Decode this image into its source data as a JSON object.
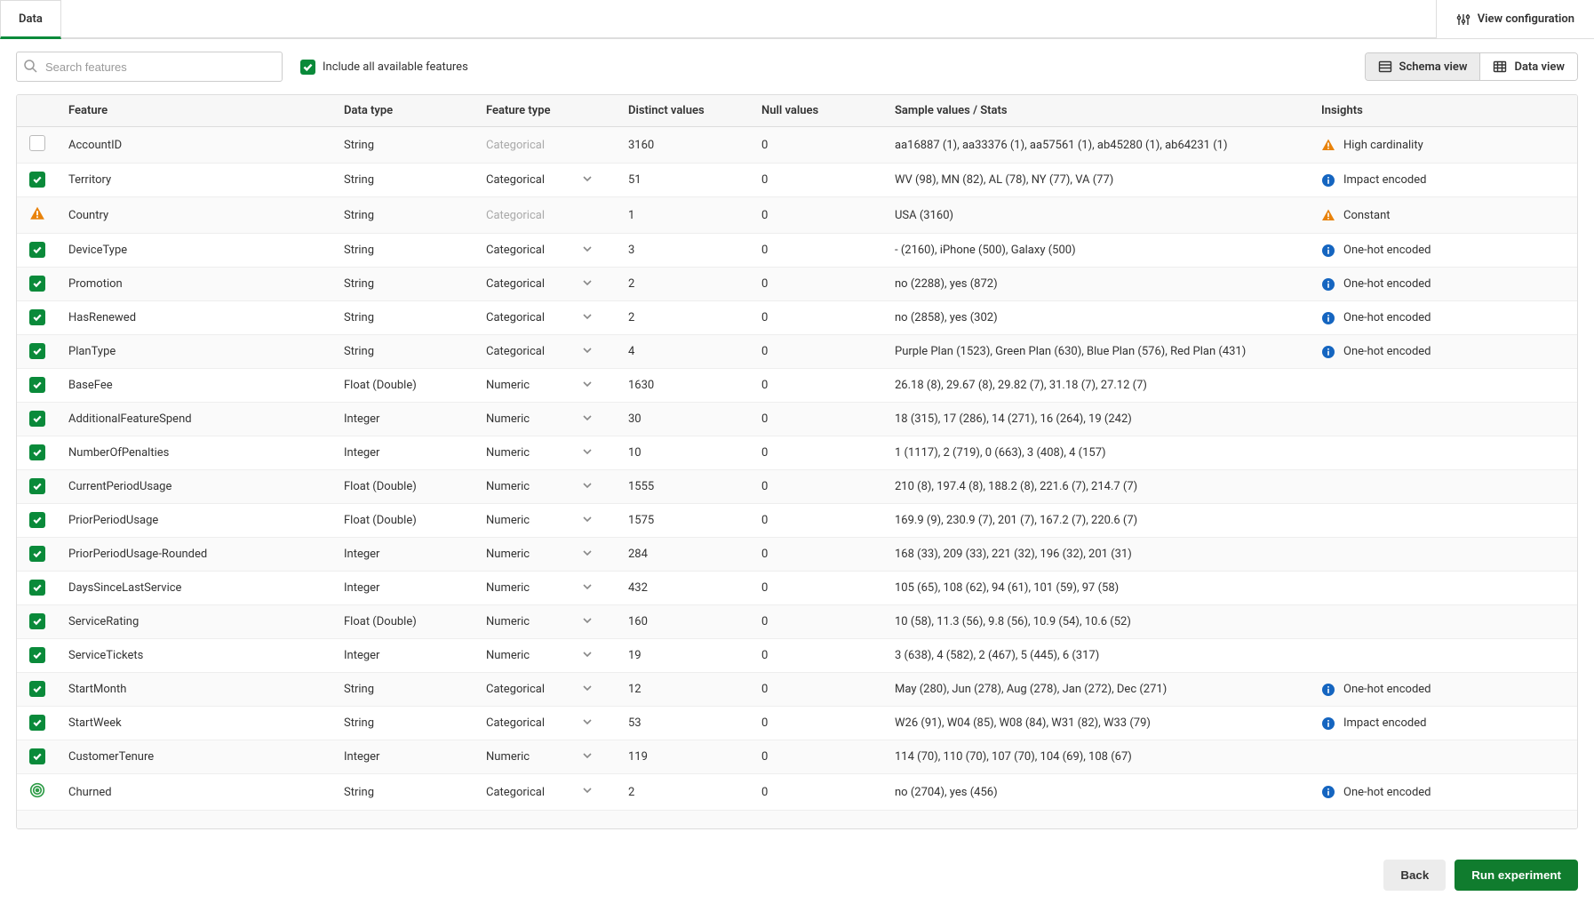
{
  "tabs": {
    "data_label": "Data"
  },
  "view_config_label": "View configuration",
  "toolbar": {
    "search_placeholder": "Search features",
    "include_all_label": "Include all available features",
    "schema_view_label": "Schema view",
    "data_view_label": "Data view"
  },
  "columns": {
    "feature": "Feature",
    "data_type": "Data type",
    "feature_type": "Feature type",
    "distinct": "Distinct values",
    "nulls": "Null values",
    "sample": "Sample values / Stats",
    "insights": "Insights"
  },
  "footer": {
    "back": "Back",
    "run": "Run experiment"
  },
  "rows": [
    {
      "status": "off",
      "feature": "AccountID",
      "data_type": "String",
      "feature_type": "Categorical",
      "ft_editable": false,
      "distinct": "3160",
      "nulls": "0",
      "sample": "aa16887 (1), aa33376 (1), aa57561 (1), ab45280 (1), ab64231 (1)",
      "insight_icon": "warn",
      "insight": "High cardinality"
    },
    {
      "status": "on",
      "feature": "Territory",
      "data_type": "String",
      "feature_type": "Categorical",
      "ft_editable": true,
      "distinct": "51",
      "nulls": "0",
      "sample": "WV (98), MN (82), AL (78), NY (77), VA (77)",
      "insight_icon": "info",
      "insight": "Impact encoded"
    },
    {
      "status": "warn",
      "feature": "Country",
      "data_type": "String",
      "feature_type": "Categorical",
      "ft_editable": false,
      "distinct": "1",
      "nulls": "0",
      "sample": "USA (3160)",
      "insight_icon": "warn",
      "insight": "Constant"
    },
    {
      "status": "on",
      "feature": "DeviceType",
      "data_type": "String",
      "feature_type": "Categorical",
      "ft_editable": true,
      "distinct": "3",
      "nulls": "0",
      "sample": "- (2160), iPhone (500), Galaxy (500)",
      "insight_icon": "info",
      "insight": "One-hot encoded"
    },
    {
      "status": "on",
      "feature": "Promotion",
      "data_type": "String",
      "feature_type": "Categorical",
      "ft_editable": true,
      "distinct": "2",
      "nulls": "0",
      "sample": "no (2288), yes (872)",
      "insight_icon": "info",
      "insight": "One-hot encoded"
    },
    {
      "status": "on",
      "feature": "HasRenewed",
      "data_type": "String",
      "feature_type": "Categorical",
      "ft_editable": true,
      "distinct": "2",
      "nulls": "0",
      "sample": "no (2858), yes (302)",
      "insight_icon": "info",
      "insight": "One-hot encoded"
    },
    {
      "status": "on",
      "feature": "PlanType",
      "data_type": "String",
      "feature_type": "Categorical",
      "ft_editable": true,
      "distinct": "4",
      "nulls": "0",
      "sample": "Purple Plan (1523), Green Plan (630), Blue Plan (576), Red Plan (431)",
      "insight_icon": "info",
      "insight": "One-hot encoded"
    },
    {
      "status": "on",
      "feature": "BaseFee",
      "data_type": "Float (Double)",
      "feature_type": "Numeric",
      "ft_editable": true,
      "distinct": "1630",
      "nulls": "0",
      "sample": "26.18 (8), 29.67 (8), 29.82 (7), 31.18 (7), 27.12 (7)",
      "insight_icon": "",
      "insight": ""
    },
    {
      "status": "on",
      "feature": "AdditionalFeatureSpend",
      "data_type": "Integer",
      "feature_type": "Numeric",
      "ft_editable": true,
      "distinct": "30",
      "nulls": "0",
      "sample": "18 (315), 17 (286), 14 (271), 16 (264), 19 (242)",
      "insight_icon": "",
      "insight": ""
    },
    {
      "status": "on",
      "feature": "NumberOfPenalties",
      "data_type": "Integer",
      "feature_type": "Numeric",
      "ft_editable": true,
      "distinct": "10",
      "nulls": "0",
      "sample": "1 (1117), 2 (719), 0 (663), 3 (408), 4 (157)",
      "insight_icon": "",
      "insight": ""
    },
    {
      "status": "on",
      "feature": "CurrentPeriodUsage",
      "data_type": "Float (Double)",
      "feature_type": "Numeric",
      "ft_editable": true,
      "distinct": "1555",
      "nulls": "0",
      "sample": "210 (8), 197.4 (8), 188.2 (8), 221.6 (7), 214.7 (7)",
      "insight_icon": "",
      "insight": ""
    },
    {
      "status": "on",
      "feature": "PriorPeriodUsage",
      "data_type": "Float (Double)",
      "feature_type": "Numeric",
      "ft_editable": true,
      "distinct": "1575",
      "nulls": "0",
      "sample": "169.9 (9), 230.9 (7), 201 (7), 167.2 (7), 220.6 (7)",
      "insight_icon": "",
      "insight": ""
    },
    {
      "status": "on",
      "feature": "PriorPeriodUsage-Rounded",
      "data_type": "Integer",
      "feature_type": "Numeric",
      "ft_editable": true,
      "distinct": "284",
      "nulls": "0",
      "sample": "168 (33), 209 (33), 221 (32), 196 (32), 201 (31)",
      "insight_icon": "",
      "insight": ""
    },
    {
      "status": "on",
      "feature": "DaysSinceLastService",
      "data_type": "Integer",
      "feature_type": "Numeric",
      "ft_editable": true,
      "distinct": "432",
      "nulls": "0",
      "sample": "105 (65), 108 (62), 94 (61), 101 (59), 97 (58)",
      "insight_icon": "",
      "insight": ""
    },
    {
      "status": "on",
      "feature": "ServiceRating",
      "data_type": "Float (Double)",
      "feature_type": "Numeric",
      "ft_editable": true,
      "distinct": "160",
      "nulls": "0",
      "sample": "10 (58), 11.3 (56), 9.8 (56), 10.9 (54), 10.6 (52)",
      "insight_icon": "",
      "insight": ""
    },
    {
      "status": "on",
      "feature": "ServiceTickets",
      "data_type": "Integer",
      "feature_type": "Numeric",
      "ft_editable": true,
      "distinct": "19",
      "nulls": "0",
      "sample": "3 (638), 4 (582), 2 (467), 5 (445), 6 (317)",
      "insight_icon": "",
      "insight": ""
    },
    {
      "status": "on",
      "feature": "StartMonth",
      "data_type": "String",
      "feature_type": "Categorical",
      "ft_editable": true,
      "distinct": "12",
      "nulls": "0",
      "sample": "May (280), Jun (278), Aug (278), Jan (272), Dec (271)",
      "insight_icon": "info",
      "insight": "One-hot encoded"
    },
    {
      "status": "on",
      "feature": "StartWeek",
      "data_type": "String",
      "feature_type": "Categorical",
      "ft_editable": true,
      "distinct": "53",
      "nulls": "0",
      "sample": "W26 (91), W04 (85), W08 (84), W31 (82), W33 (79)",
      "insight_icon": "info",
      "insight": "Impact encoded"
    },
    {
      "status": "on",
      "feature": "CustomerTenure",
      "data_type": "Integer",
      "feature_type": "Numeric",
      "ft_editable": true,
      "distinct": "119",
      "nulls": "0",
      "sample": "114 (70), 110 (70), 107 (70), 104 (69), 108 (67)",
      "insight_icon": "",
      "insight": ""
    },
    {
      "status": "target",
      "feature": "Churned",
      "data_type": "String",
      "feature_type": "Categorical",
      "ft_editable": true,
      "distinct": "2",
      "nulls": "0",
      "sample": "no (2704), yes (456)",
      "insight_icon": "info",
      "insight": "One-hot encoded"
    }
  ]
}
